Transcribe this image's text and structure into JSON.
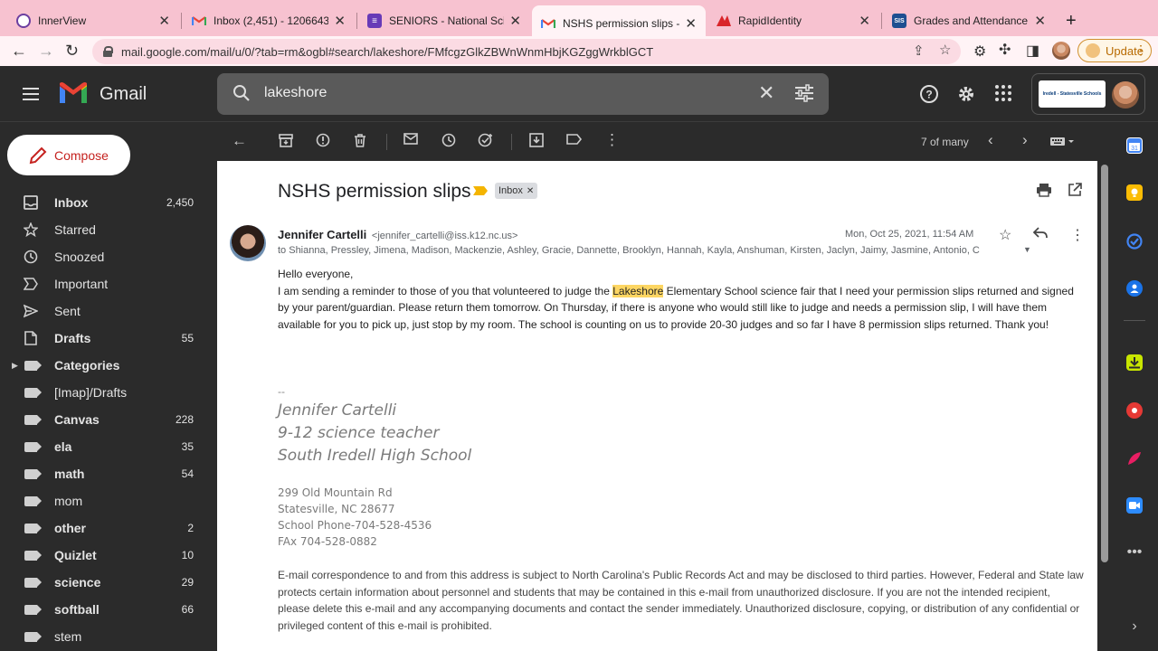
{
  "browser": {
    "tabs": [
      {
        "title": "InnerView",
        "favicon": "innerview-icon",
        "color": "#6b3fa0"
      },
      {
        "title": "Inbox (2,451) - 1206643",
        "favicon": "gmail-icon",
        "color": "#ea4335"
      },
      {
        "title": "SENIORS - National Scie",
        "favicon": "forms-icon",
        "color": "#673ab7"
      },
      {
        "title": "NSHS permission slips -",
        "favicon": "gmail-icon",
        "color": "#ea4335"
      },
      {
        "title": "RapidIdentity",
        "favicon": "rapididentity-icon",
        "color": "#d9252a"
      },
      {
        "title": "Grades and Attendance",
        "favicon": "sis-icon",
        "color": "#1d4f91"
      }
    ],
    "sis_favicon_text": "SIS",
    "url": "mail.google.com/mail/u/0/?tab=rm&ogbl#search/lakeshore/FMfcgzGlkZBWnWnmHbjKGZggWrkblGCT",
    "update_label": "Update"
  },
  "gmail": {
    "app_name": "Gmail",
    "search_value": "lakeshore",
    "org_badge_text": "Iredell - Statesville Schools",
    "compose_label": "Compose",
    "nav": [
      {
        "label": "Inbox",
        "count": "2,450",
        "icon": "inbox-icon",
        "bold": true
      },
      {
        "label": "Starred",
        "count": "",
        "icon": "star-icon",
        "bold": false
      },
      {
        "label": "Snoozed",
        "count": "",
        "icon": "clock-icon",
        "bold": false
      },
      {
        "label": "Important",
        "count": "",
        "icon": "important-icon",
        "bold": false
      },
      {
        "label": "Sent",
        "count": "",
        "icon": "send-icon",
        "bold": false
      },
      {
        "label": "Drafts",
        "count": "55",
        "icon": "draft-icon",
        "bold": true
      },
      {
        "label": "Categories",
        "count": "",
        "icon": "label-icon",
        "bold": true,
        "caret": true
      },
      {
        "label": "[Imap]/Drafts",
        "count": "",
        "icon": "label-icon",
        "bold": false
      },
      {
        "label": "Canvas",
        "count": "228",
        "icon": "label-icon",
        "bold": true
      },
      {
        "label": "ela",
        "count": "35",
        "icon": "label-icon",
        "bold": true
      },
      {
        "label": "math",
        "count": "54",
        "icon": "label-icon",
        "bold": true
      },
      {
        "label": "mom",
        "count": "",
        "icon": "label-icon",
        "bold": false
      },
      {
        "label": "other",
        "count": "2",
        "icon": "label-icon",
        "bold": true
      },
      {
        "label": "Quizlet",
        "count": "10",
        "icon": "label-icon",
        "bold": true
      },
      {
        "label": "science",
        "count": "29",
        "icon": "label-icon",
        "bold": true
      },
      {
        "label": "softball",
        "count": "66",
        "icon": "label-icon",
        "bold": true
      },
      {
        "label": "stem",
        "count": "",
        "icon": "label-icon",
        "bold": false
      }
    ],
    "pager": "7 of many",
    "message": {
      "subject": "NSHS permission slips",
      "label_chip": "Inbox",
      "sender_name": "Jennifer Cartelli",
      "sender_email": "<jennifer_cartelli@iss.k12.nc.us>",
      "date": "Mon, Oct 25, 2021, 11:54 AM",
      "to": "to Shianna, Pressley, Jimena, Madison, Mackenzie, Ashley, Gracie, Dannette, Brooklyn, Hannah, Kayla, Anshuman, Kirsten, Jaclyn, Jaimy, Jasmine, Antonio, C",
      "greeting": "Hello everyone,",
      "body_before": "I am sending a reminder to those of you that volunteered to judge the ",
      "body_highlight": "Lakeshore",
      "body_after": " Elementary School science fair that I need your permission slips returned and signed by your parent/guardian. Please return them tomorrow. On Thursday, if there is anyone who would still like to judge and needs a permission slip, I will have them available for you to pick up, just stop by my room. The school is counting on us to provide 20-30 judges and so far I have 8 permission slips returned. Thank you!",
      "sig_dash": "--",
      "sig_name": "Jennifer Cartelli",
      "sig_title": "9-12 science teacher",
      "sig_school": "South Iredell High School",
      "addr1": "299 Old Mountain Rd",
      "addr2": "Statesville, NC 28677",
      "phone": "School Phone-704-528-4536",
      "fax": "FAx 704-528-0882",
      "disclaimer": "E-mail correspondence to and from this address is subject to North Carolina's Public Records Act and may be disclosed to third parties. However, Federal and State law protects certain information about personnel and students that may be contained in this e-mail from unauthorized disclosure. If you are not the intended recipient, please delete this e-mail and any accompanying documents and contact the sender immediately. Unauthorized disclosure, copying, or distribution of any confidential or privileged content of this e-mail is prohibited."
    }
  }
}
